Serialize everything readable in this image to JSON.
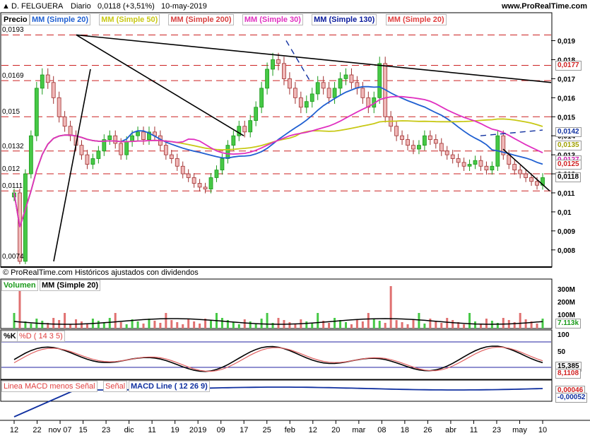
{
  "header": {
    "ticker": "D. FELGUERA",
    "period": "Diario",
    "last": "0,0118 (+3,51%)",
    "date": "10-may-2019",
    "site": "www.ProRealTime.com"
  },
  "price_panel": {
    "label": "Precio",
    "indicators": [
      {
        "text": "MM (Simple 20)",
        "color": "#1f5fd1"
      },
      {
        "text": "MM (Simple 50)",
        "color": "#c8c814"
      },
      {
        "text": "MM (Simple 200)",
        "color": "#d84040"
      },
      {
        "text": "MM (Simple 30)",
        "color": "#e030c0"
      },
      {
        "text": "MM (Simple 130)",
        "color": "#0a1a9c"
      },
      {
        "text": "MM (Simple 20)",
        "color": "#e04040"
      }
    ],
    "left_levels": [
      "0,0193",
      "0,0169",
      "0,015",
      "0,0132",
      "0,012",
      "0,0111",
      "0,0074"
    ],
    "copyright": "© ProRealTime.com  Históricos ajustados con dividendos",
    "tags": [
      {
        "text": "0,0177",
        "color": "#d02020"
      },
      {
        "text": "0,0142",
        "color": "#1030a0"
      },
      {
        "text": "0,0135",
        "color": "#a0a000"
      },
      {
        "text": "0,0127",
        "color": "#d020b0"
      },
      {
        "text": "0,0125",
        "color": "#d02020"
      },
      {
        "text": "0,0118",
        "color": "#000000"
      }
    ]
  },
  "volume_panel": {
    "label": "Volumen",
    "indicator": "MM (Simple 20)",
    "axis": [
      "300M",
      "200M",
      "100M"
    ],
    "tags": [
      "7.113k"
    ]
  },
  "stoch_panel": {
    "label": "%K",
    "indicator": "%D ( 14 3 5)",
    "axis": [
      "100",
      "50"
    ],
    "tags": [
      "15,385",
      "8,1108"
    ]
  },
  "macd_panel": {
    "label1": "Linea MACD menos Señal",
    "label2": "Señal",
    "label3": "MACD Line ( 12 26 9)",
    "tags": [
      "0,00046",
      "-0,00052"
    ]
  },
  "x_axis": [
    "12",
    "22",
    "nov 07",
    "15",
    "23",
    "dic",
    "11",
    "19",
    "2019",
    "09",
    "17",
    "25",
    "feb",
    "12",
    "20",
    "mar",
    "08",
    "18",
    "26",
    "abr",
    "11",
    "23",
    "may",
    "10"
  ],
  "chart_data": {
    "type": "line",
    "title": "D. FELGUERA Diario",
    "y_ticks": [
      0.019,
      0.018,
      0.017,
      0.016,
      0.015,
      0.014,
      0.013,
      0.012,
      0.011,
      0.01,
      0.009,
      0.008
    ],
    "y_tick_labels": [
      "0,019",
      "0,018",
      "0,017",
      "0,016",
      "0,015",
      "0,014",
      "0,013",
      "0,012",
      "0,011",
      "0,01",
      "0,009",
      "0,008"
    ],
    "ylim": [
      0.0071,
      0.0198
    ],
    "close": [
      0.011,
      0.0074,
      0.012,
      0.014,
      0.0165,
      0.0172,
      0.0168,
      0.016,
      0.015,
      0.0145,
      0.014,
      0.0135,
      0.013,
      0.0125,
      0.0128,
      0.0132,
      0.0138,
      0.014,
      0.0136,
      0.013,
      0.0137,
      0.014,
      0.0142,
      0.0138,
      0.0142,
      0.014,
      0.0135,
      0.013,
      0.0128,
      0.0124,
      0.012,
      0.0118,
      0.0115,
      0.0113,
      0.0112,
      0.0118,
      0.0122,
      0.0128,
      0.0135,
      0.014,
      0.0145,
      0.0142,
      0.0148,
      0.0155,
      0.0165,
      0.0175,
      0.018,
      0.0178,
      0.017,
      0.0165,
      0.016,
      0.0155,
      0.0158,
      0.0162,
      0.0168,
      0.0165,
      0.016,
      0.0165,
      0.017,
      0.0172,
      0.0168,
      0.0165,
      0.016,
      0.0155,
      0.016,
      0.0178,
      0.015,
      0.0145,
      0.014,
      0.0138,
      0.0135,
      0.0133,
      0.0135,
      0.014,
      0.0138,
      0.0136,
      0.0132,
      0.013,
      0.0128,
      0.0126,
      0.0124,
      0.0125,
      0.0127,
      0.0124,
      0.0122,
      0.0124,
      0.014,
      0.013,
      0.0125,
      0.0122,
      0.012,
      0.0118,
      0.0116,
      0.0114,
      0.0118
    ],
    "series_lines": [
      {
        "name": "MM (Simple 20)",
        "color": "#1f5fd1"
      },
      {
        "name": "MM (Simple 50)",
        "color": "#c8c814"
      },
      {
        "name": "MM (Simple 30)",
        "color": "#e030c0"
      }
    ]
  }
}
